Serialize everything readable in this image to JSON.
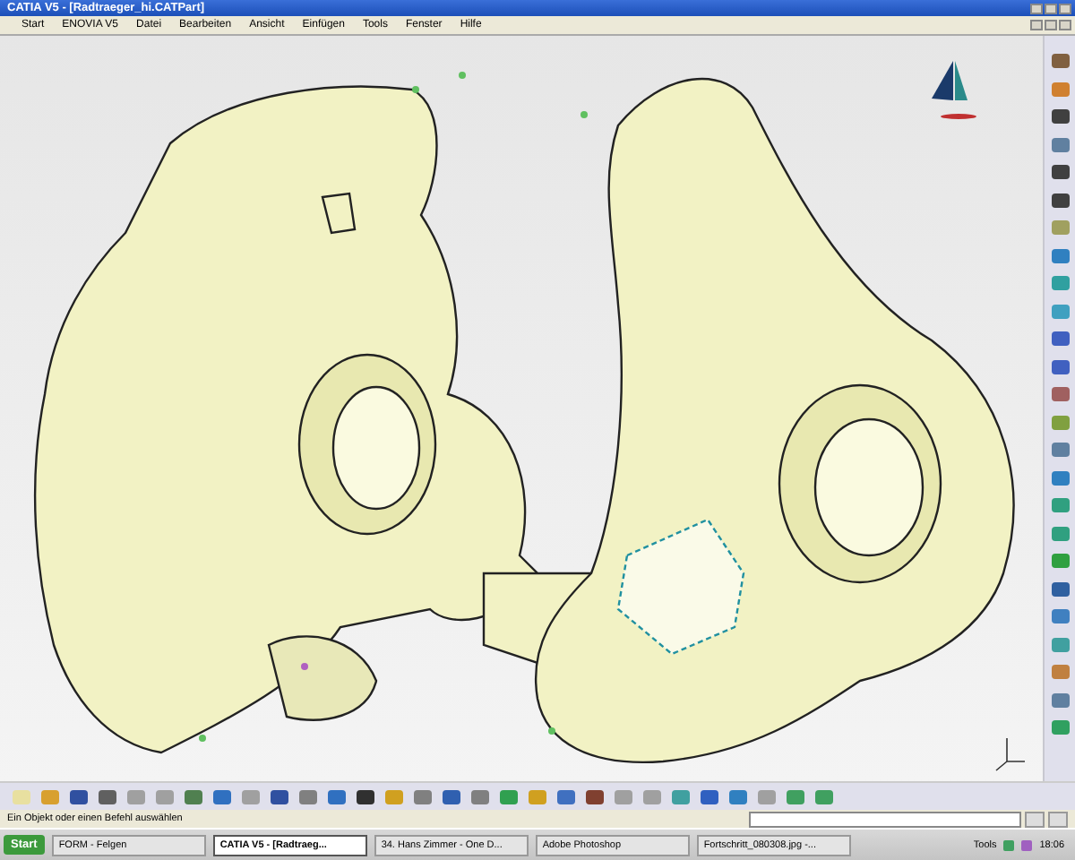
{
  "window": {
    "title": "CATIA V5 - [Radtraeger_hi.CATPart]"
  },
  "menu": [
    {
      "label": "Start"
    },
    {
      "label": "ENOVIA V5"
    },
    {
      "label": "Datei"
    },
    {
      "label": "Bearbeiten"
    },
    {
      "label": "Ansicht"
    },
    {
      "label": "Einfügen"
    },
    {
      "label": "Tools"
    },
    {
      "label": "Fenster"
    },
    {
      "label": "Hilfe"
    }
  ],
  "status_bar": {
    "message": "Ein Objekt oder einen Befehl auswählen"
  },
  "taskbar": {
    "start": "Start",
    "items": [
      {
        "label": "FORM - Felgen",
        "selected": false
      },
      {
        "label": "CATIA V5 - [Radtraeg...",
        "selected": true
      },
      {
        "label": "34. Hans Zimmer - One D...",
        "selected": false
      },
      {
        "label": "Adobe Photoshop",
        "selected": false
      },
      {
        "label": "Fortschritt_080308.jpg -...",
        "selected": false
      }
    ],
    "tray_label": "Tools",
    "clock": "18:06"
  }
}
